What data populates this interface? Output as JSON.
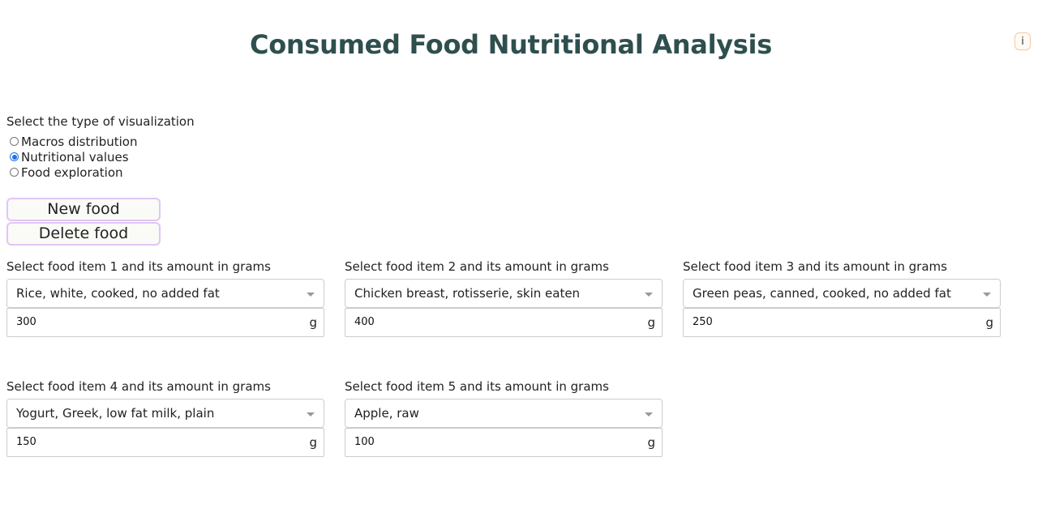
{
  "header": {
    "title": "Consumed Food Nutritional Analysis",
    "info_label": "i"
  },
  "visualization": {
    "label": "Select the type of visualization",
    "options": [
      {
        "label": "Macros distribution",
        "checked": false
      },
      {
        "label": "Nutritional values",
        "checked": true
      },
      {
        "label": "Food exploration",
        "checked": false
      }
    ]
  },
  "actions": {
    "new_food_label": "New food",
    "delete_food_label": "Delete food"
  },
  "food_items": [
    {
      "label": "Select food item 1 and its amount in grams",
      "food": "Rice, white, cooked, no added fat",
      "amount": "300",
      "unit": "g"
    },
    {
      "label": "Select food item 2 and its amount in grams",
      "food": "Chicken breast, rotisserie, skin eaten",
      "amount": "400",
      "unit": "g"
    },
    {
      "label": "Select food item 3 and its amount in grams",
      "food": "Green peas, canned, cooked, no added fat",
      "amount": "250",
      "unit": "g"
    },
    {
      "label": "Select food item 4 and its amount in grams",
      "food": "Yogurt, Greek, low fat milk, plain",
      "amount": "150",
      "unit": "g"
    },
    {
      "label": "Select food item 5 and its amount in grams",
      "food": "Apple, raw",
      "amount": "100",
      "unit": "g"
    }
  ]
}
